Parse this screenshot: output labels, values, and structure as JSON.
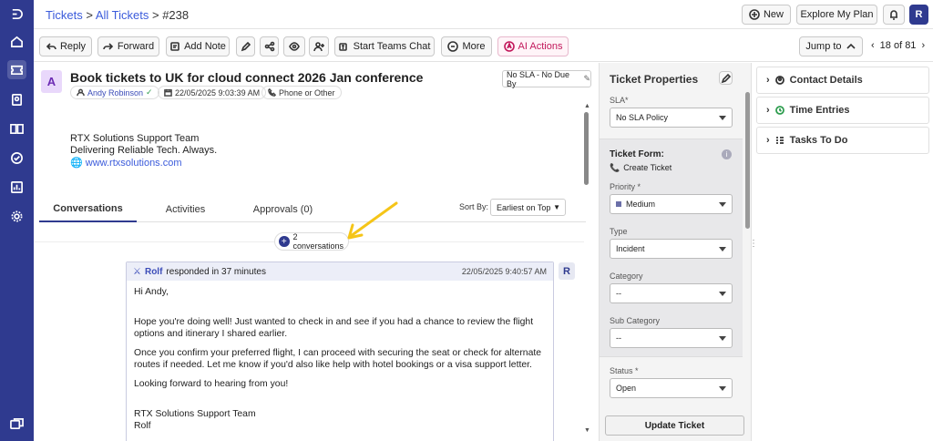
{
  "breadcrumb": {
    "tickets": "Tickets",
    "sep1": ">",
    "all": "All Tickets",
    "sep2": ">",
    "current": "#238"
  },
  "header": {
    "new_label": "New",
    "explore_label": "Explore My Plan",
    "user_initial": "R"
  },
  "toolbar": {
    "reply": "Reply",
    "forward": "Forward",
    "add_note": "Add Note",
    "teams": "Start Teams Chat",
    "more": "More",
    "ai": "AI Actions",
    "jump": "Jump to",
    "pager": "18 of 81"
  },
  "ticket": {
    "avatar": "A",
    "title": "Book tickets to UK for cloud connect 2026 Jan conference",
    "requester": "Andy Robinson",
    "created": "22/05/2025 9:03:39 AM",
    "source": "Phone or Other",
    "sla_status": "No SLA - No Due By"
  },
  "signature": {
    "line1": "RTX Solutions Support Team",
    "line2": "Delivering Reliable Tech. Always.",
    "url": "www.rtxsolutions.com"
  },
  "tabs": [
    {
      "label": "Conversations"
    },
    {
      "label": "Activities"
    },
    {
      "label": "Approvals (0)"
    }
  ],
  "sort": {
    "label": "Sort By:",
    "value": "Earliest on Top"
  },
  "conversations_count": "2 conversations",
  "message": {
    "author": "Rolf",
    "meta": "responded in 37 minutes",
    "datetime": "22/05/2025 9:40:57 AM",
    "avatar": "R",
    "greeting": "Hi Andy,",
    "p1": "Hope you're doing well! Just wanted to check in and see if you had a chance to review the flight options and itinerary I shared earlier.",
    "p2": "Once you confirm your preferred flight, I can proceed with securing the seat or check for alternate routes if needed. Let me know if you'd also like help with hotel bookings or a visa support letter.",
    "p3": "Looking forward to hearing from you!",
    "sig1": "RTX Solutions Support Team",
    "sig2": "Rolf"
  },
  "props": {
    "title": "Ticket Properties",
    "sla_label": "SLA*",
    "sla_value": "No SLA Policy",
    "form_label": "Ticket Form:",
    "form_value": "Create Ticket",
    "priority_label": "Priority *",
    "priority_value": "Medium",
    "type_label": "Type",
    "type_value": "Incident",
    "category_label": "Category",
    "category_value": "--",
    "subcat_label": "Sub Category",
    "subcat_value": "--",
    "status_label": "Status *",
    "status_value": "Open",
    "update_button": "Update Ticket"
  },
  "side": {
    "contact": "Contact Details",
    "time": "Time Entries",
    "tasks": "Tasks To Do"
  },
  "colors": {
    "rail": "#2f3a8f",
    "accent": "#3b5bdb",
    "ai": "#c2185b",
    "annotation_arrow": "#f5c518"
  }
}
